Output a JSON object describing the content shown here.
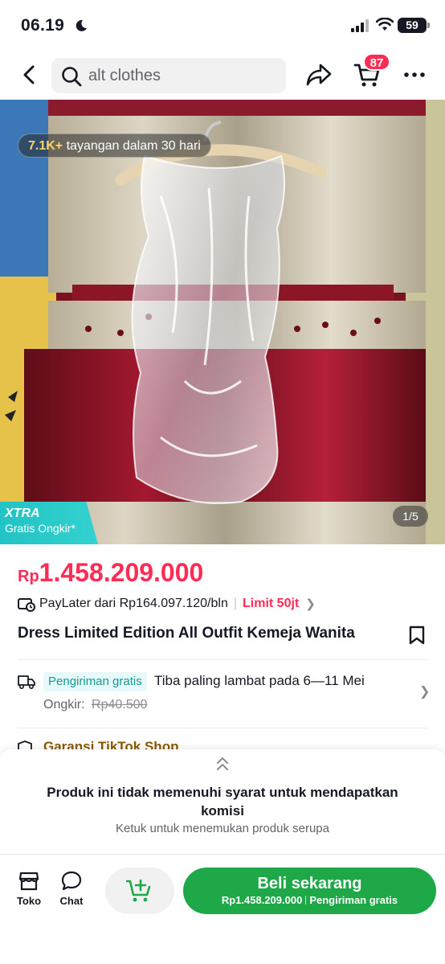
{
  "status_bar": {
    "time": "06.19",
    "battery": "59"
  },
  "header": {
    "search_text": "alt clothes",
    "cart_count": "87"
  },
  "gallery": {
    "views_count": "7.1K+",
    "views_text": "tayangan dalam 30 hari",
    "promo_title": "XTRA",
    "promo_text": "Gratis Ongkir*",
    "counter": "1/5"
  },
  "product": {
    "currency": "Rp",
    "price": "1.458.209.000",
    "paylater_text": "PayLater dari Rp164.097.120/bln",
    "paylater_limit": "Limit 50jt",
    "title": "Dress Limited Edition All Outfit Kemeja Wanita"
  },
  "shipping": {
    "badge": "Pengiriman gratis",
    "eta": "Tiba paling lambat pada 6—11 Mei",
    "ongkir_label": "Ongkir:",
    "ongkir_old": "Rp40.500"
  },
  "garansi": {
    "text": "Garansi TikTok Shop"
  },
  "commission": {
    "message": "Produk ini tidak memenuhi syarat untuk mendapatkan komisi",
    "subtext": "Ketuk untuk menemukan produk serupa"
  },
  "bottom_bar": {
    "shop_label": "Toko",
    "chat_label": "Chat",
    "buy_label": "Beli sekarang",
    "buy_price": "Rp1.458.209.000",
    "buy_shipping": "Pengiriman gratis"
  },
  "colors": {
    "accent_red": "#fe2c55",
    "buy_green": "#1ea848",
    "xtra_teal": "#22c3c4"
  }
}
